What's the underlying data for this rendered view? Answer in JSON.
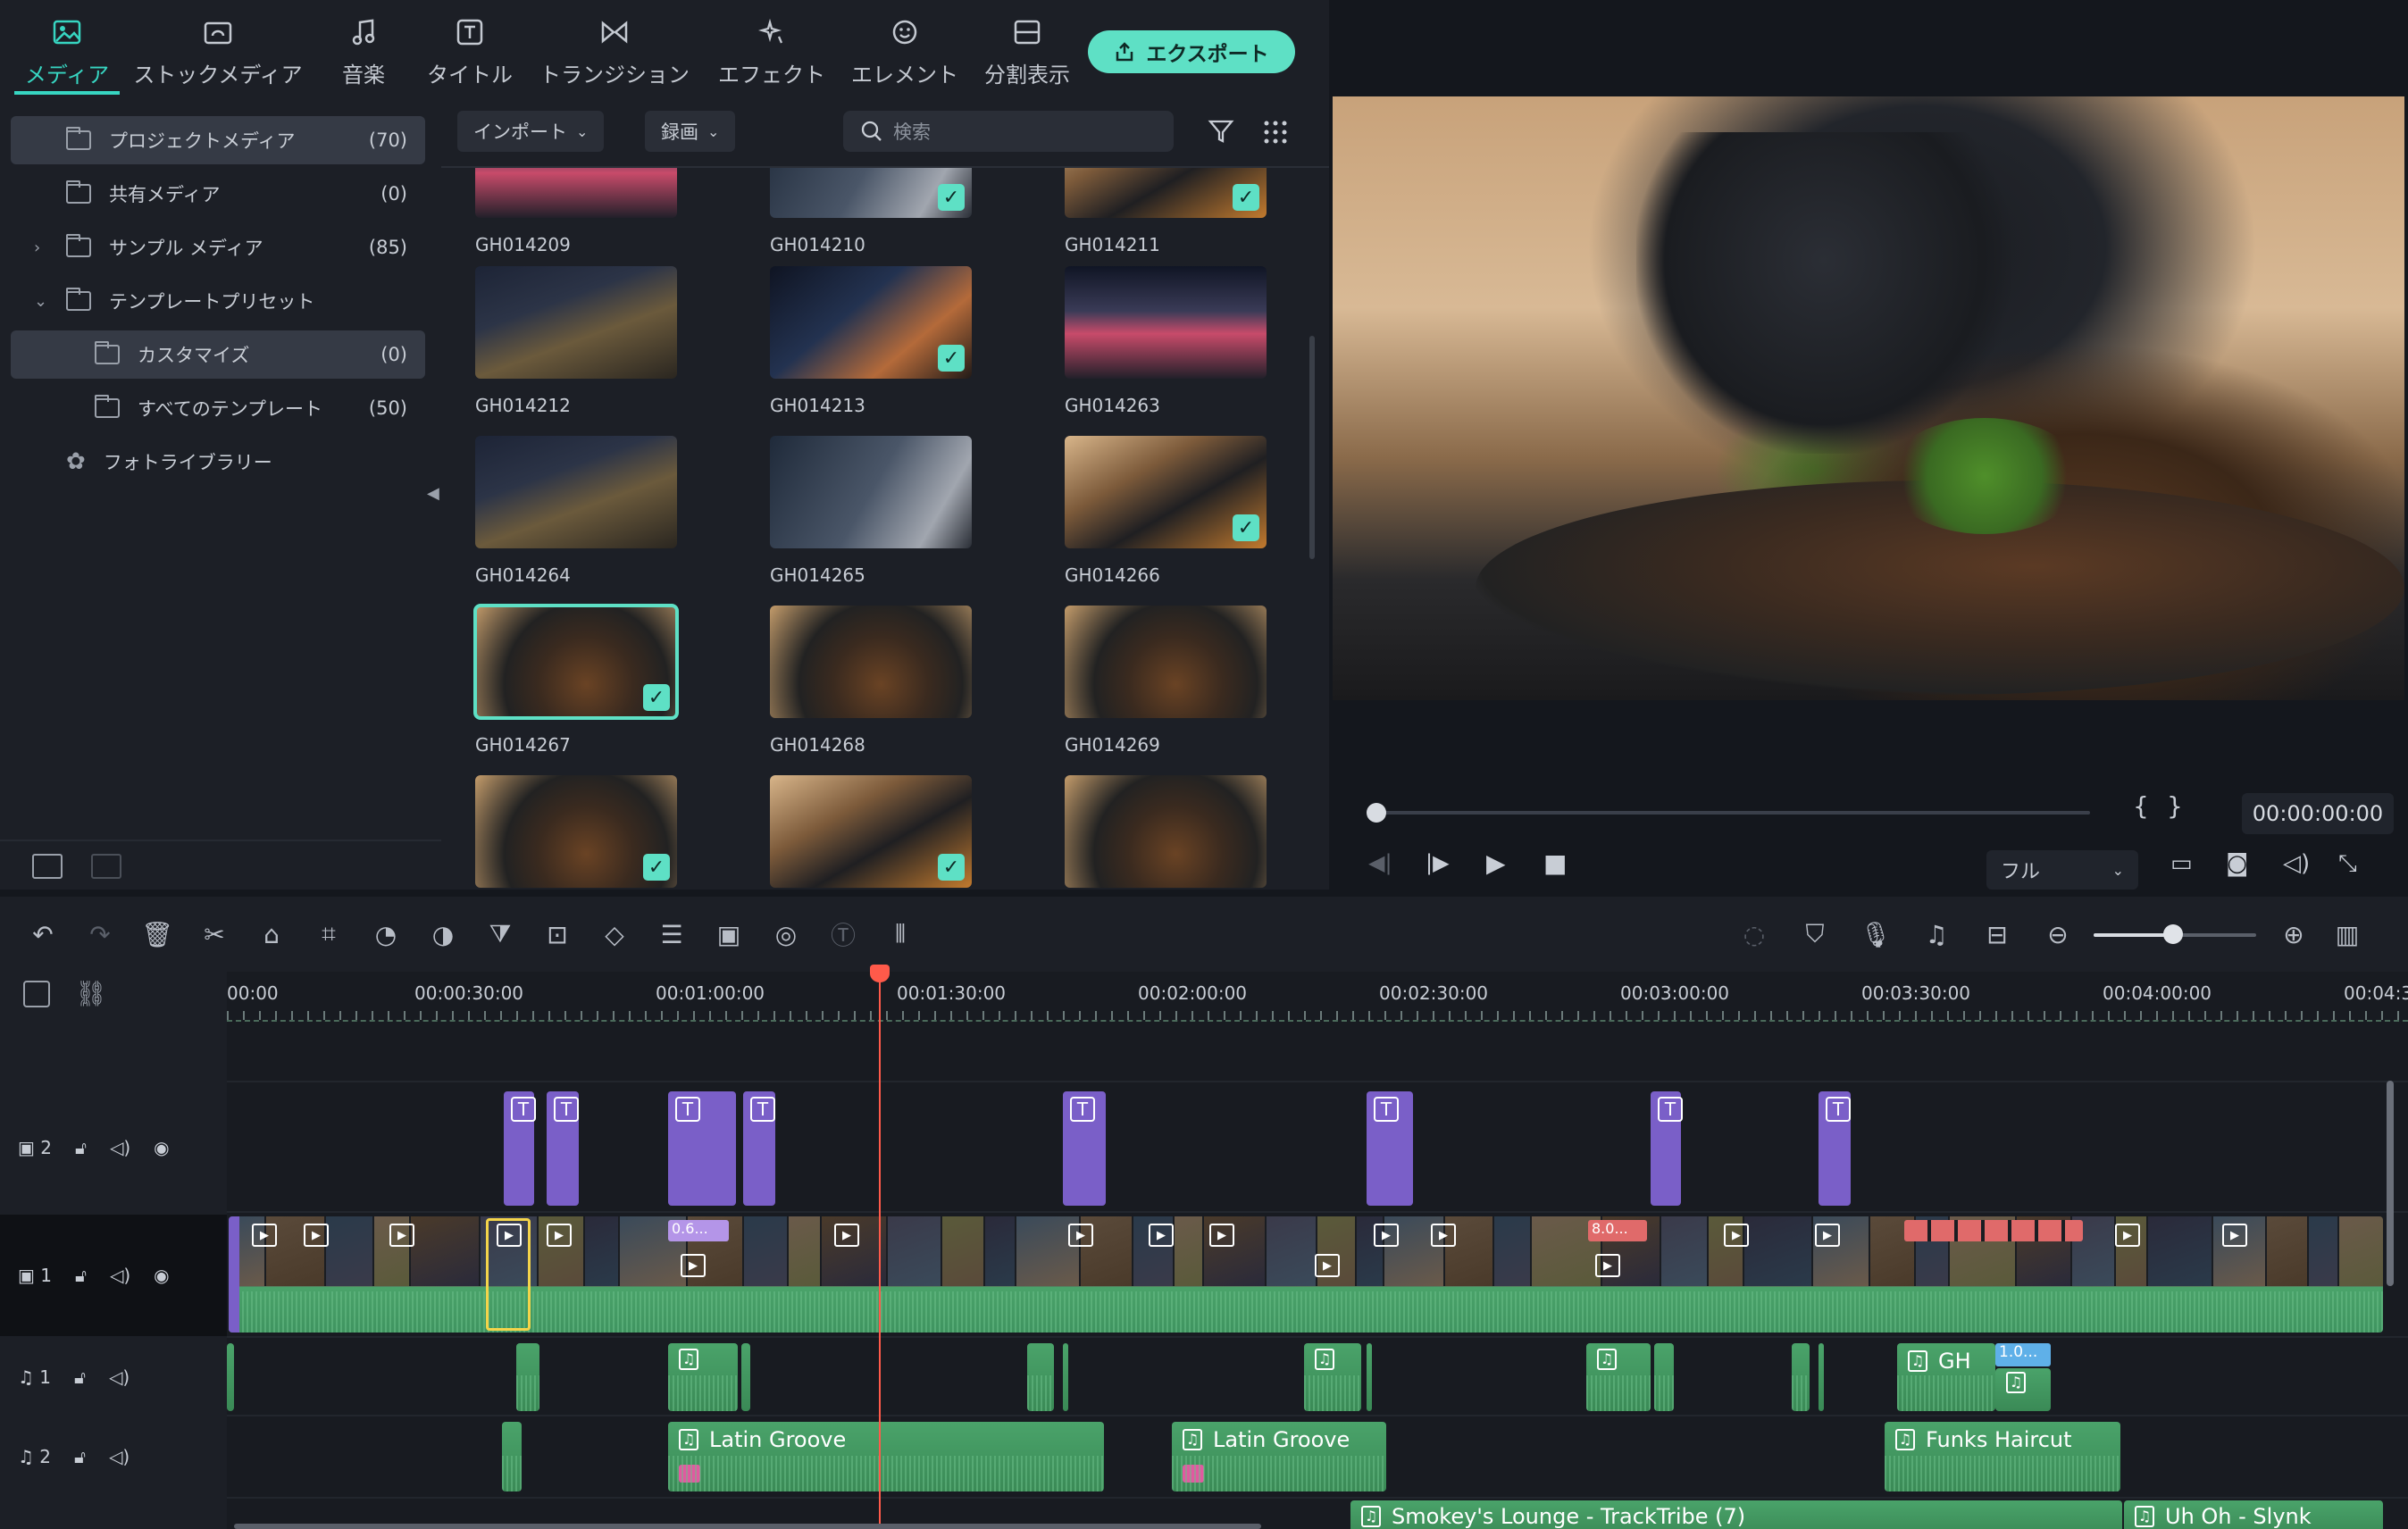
{
  "nav": {
    "tabs": [
      {
        "label": "メディア",
        "icon": "media-icon",
        "active": true
      },
      {
        "label": "ストックメディア",
        "icon": "stock-media-icon"
      },
      {
        "label": "音楽",
        "icon": "music-icon"
      },
      {
        "label": "タイトル",
        "icon": "title-icon"
      },
      {
        "label": "トランジション",
        "icon": "transition-icon"
      },
      {
        "label": "エフェクト",
        "icon": "effect-icon"
      },
      {
        "label": "エレメント",
        "icon": "element-icon"
      },
      {
        "label": "分割表示",
        "icon": "split-view-icon"
      }
    ],
    "export_label": "エクスポート"
  },
  "library": {
    "items": [
      {
        "label": "プロジェクトメディア",
        "count": "(70)"
      },
      {
        "label": "共有メディア",
        "count": "(0)"
      },
      {
        "label": "サンプル メディア",
        "count": "(85)"
      },
      {
        "label": "テンプレートプリセット",
        "count": ""
      },
      {
        "label": "カスタマイズ",
        "count": "(0)"
      },
      {
        "label": "すべてのテンプレート",
        "count": "(50)"
      },
      {
        "label": "フォトライブラリー",
        "count": ""
      }
    ]
  },
  "browser": {
    "import_label": "インポート",
    "record_label": "録画",
    "search_placeholder": "検索",
    "clips": [
      {
        "name": "GH014209",
        "checked": false
      },
      {
        "name": "GH014210",
        "checked": true
      },
      {
        "name": "GH014211",
        "checked": true
      },
      {
        "name": "GH014212",
        "checked": false
      },
      {
        "name": "GH014213",
        "checked": true
      },
      {
        "name": "GH014263",
        "checked": false
      },
      {
        "name": "GH014264",
        "checked": false
      },
      {
        "name": "GH014265",
        "checked": false
      },
      {
        "name": "GH014266",
        "checked": true
      },
      {
        "name": "GH014267",
        "checked": true
      },
      {
        "name": "GH014268",
        "checked": false
      },
      {
        "name": "GH014269",
        "checked": false
      },
      {
        "name": "",
        "checked": true
      },
      {
        "name": "",
        "checked": true
      },
      {
        "name": "",
        "checked": false
      }
    ]
  },
  "preview": {
    "timecode": "00:00:00:00",
    "quality": "フル",
    "mark_in": "{",
    "mark_out": "}"
  },
  "timeline": {
    "ruler_labels": [
      "00:00",
      "00:00:30:00",
      "00:01:00:00",
      "00:01:30:00",
      "00:02:00:00",
      "00:02:30:00",
      "00:03:00:00",
      "00:03:30:00",
      "00:04:00:00",
      "00:04:3"
    ],
    "tracks": {
      "video2": "2",
      "video1": "1",
      "audio1": "1",
      "audio2": "2"
    },
    "audio_clips": {
      "latin1": "Latin Groove",
      "latin2": "Latin Groove",
      "funks": "Funks Haircut",
      "smokey": "Smokey's Lounge - TrackTribe (7)",
      "uhoh": "Uh Oh - Slynk",
      "gh_short": "GH",
      "gh_badge": "1.0..."
    },
    "video_badges": {
      "speed1": "0.6...",
      "speed2": "8.0..."
    }
  },
  "colors": {
    "accent": "#5ee0c5",
    "title_clip": "#7a5fc8",
    "audio_clip": "#4aa36a",
    "playhead": "#ff5a4a"
  }
}
